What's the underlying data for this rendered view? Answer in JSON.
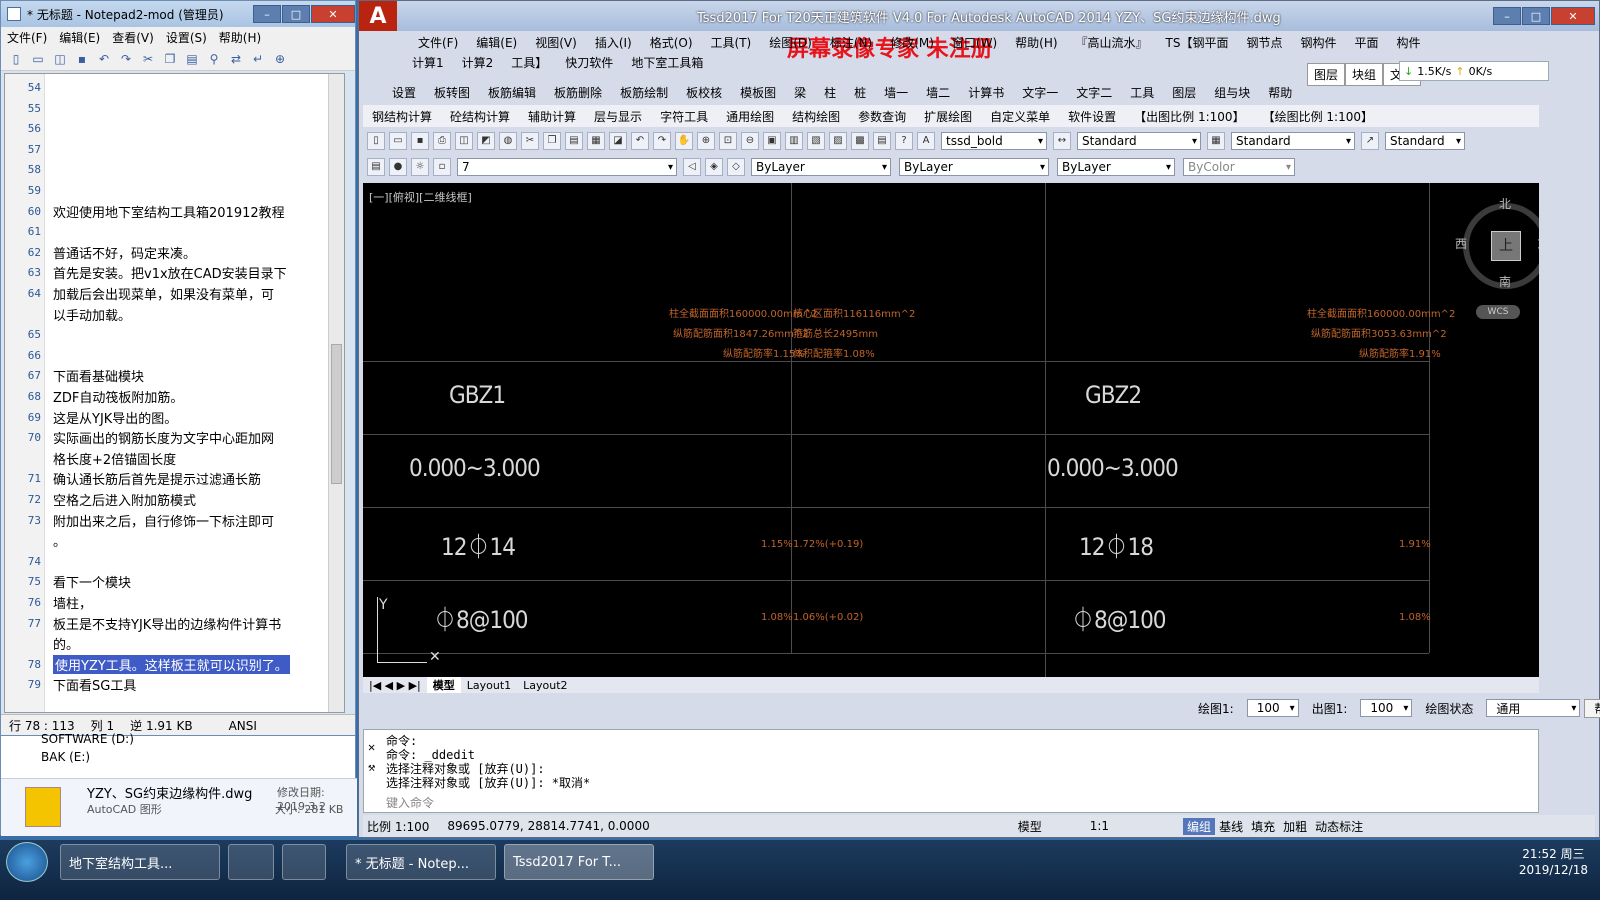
{
  "notepad": {
    "title": "* 无标题 - Notepad2-mod (管理员)",
    "menu": [
      "文件(F)",
      "编辑(E)",
      "查看(V)",
      "设置(S)",
      "帮助(H)"
    ],
    "lines": [
      {
        "n": "54",
        "t": ""
      },
      {
        "n": "55",
        "t": ""
      },
      {
        "n": "56",
        "t": ""
      },
      {
        "n": "57",
        "t": ""
      },
      {
        "n": "58",
        "t": ""
      },
      {
        "n": "59",
        "t": ""
      },
      {
        "n": "60",
        "t": "欢迎使用地下室结构工具箱201912教程"
      },
      {
        "n": "61",
        "t": ""
      },
      {
        "n": "62",
        "t": "普通话不好，码定来凑。"
      },
      {
        "n": "63",
        "t": "首先是安装。把v1x放在CAD安装目录下"
      },
      {
        "n": "64",
        "t": "加载后会出现菜单，如果没有菜单，可"
      },
      {
        "n": "",
        "t": "以手动加载。"
      },
      {
        "n": "65",
        "t": ""
      },
      {
        "n": "66",
        "t": ""
      },
      {
        "n": "67",
        "t": "下面看基础模块"
      },
      {
        "n": "68",
        "t": "ZDF自动筏板附加筋。"
      },
      {
        "n": "69",
        "t": "这是从YJK导出的图。"
      },
      {
        "n": "70",
        "t": "实际画出的钢筋长度为文字中心距加网"
      },
      {
        "n": "",
        "t": "格长度+2倍锚固长度"
      },
      {
        "n": "71",
        "t": "确认通长筋后首先是提示过滤通长筋"
      },
      {
        "n": "72",
        "t": "空格之后进入附加筋模式"
      },
      {
        "n": "73",
        "t": "附加出来之后，自行修饰一下标注即可"
      },
      {
        "n": "",
        "t": "。"
      },
      {
        "n": "74",
        "t": ""
      },
      {
        "n": "75",
        "t": "看下一个模块"
      },
      {
        "n": "76",
        "t": "墙柱，"
      },
      {
        "n": "77",
        "t": "板王是不支持YJK导出的边缘构件计算书"
      },
      {
        "n": "",
        "t": "的。"
      },
      {
        "n": "78",
        "t": "使用YZY工具。这样板王就可以识别了。"
      },
      {
        "n": "79",
        "t": "下面看SG工具"
      }
    ],
    "status": {
      "pos": "行 78 : 113",
      "col": "列 1",
      "size": "逆 1.91 KB",
      "enc": "ANSI"
    }
  },
  "explorer": {
    "drive1": "SOFTWARE (D:)",
    "drive2": "BAK (E:)",
    "file": "YZY、SG约束边缘构件.dwg",
    "modified": "修改日期: 2019.3.2",
    "type": "AutoCAD 图形",
    "size": "大小: 281 KB"
  },
  "cad": {
    "title": "Tssd2017 For T20天正建筑软件 V4.0 For Autodesk AutoCAD 2014    YZY、SG约束边缘构件.dwg",
    "watermark": "屏幕录像专家  未注册",
    "menu1": [
      "文件(F)",
      "编辑(E)",
      "视图(V)",
      "插入(I)",
      "格式(O)",
      "工具(T)",
      "绘图(D)",
      "标注(N)",
      "修改(M)",
      "窗口(W)",
      "帮助(H)",
      "『高山流水』",
      "TS【钢平面",
      "钢节点",
      "钢构件",
      "平面",
      "构件"
    ],
    "menu2": [
      "计算1",
      "计算2",
      "工具】",
      "快刀软件",
      "地下室工具箱"
    ],
    "menu3": [
      "设置",
      "板转图",
      "板筋编辑",
      "板筋删除",
      "板筋绘制",
      "板校核",
      "模板图",
      "梁",
      "柱",
      "桩",
      "墙一",
      "墙二",
      "计算书",
      "文字一",
      "文字二",
      "工具",
      "图层",
      "组与块",
      "帮助"
    ],
    "menu4": [
      "钢结构计算",
      "砼结构计算",
      "辅助计算",
      "层与显示",
      "字符工具",
      "通用绘图",
      "结构绘图",
      "参数查询",
      "扩展绘图",
      "自定义菜单",
      "软件设置",
      "【出图比例 1:100】",
      "【绘图比例 1:100】"
    ],
    "right_tabs": [
      "图层",
      "块组",
      "文字"
    ],
    "net": {
      "down": "1.5K/s",
      "up": "0K/s"
    },
    "style_combo": "tssd_bold",
    "dim_combo": "Standard",
    "table_combo": "Standard",
    "mleader": "Standard",
    "layer": "7",
    "color": "ByLayer",
    "linetype": "ByLayer",
    "lineweight": "ByLayer",
    "plotstyle": "ByColor",
    "viewport_label": "[一][俯视][二维线框]",
    "cells": {
      "a_notes": [
        "柱全截面面积160000.00mm^2",
        "纵筋配筋面积1847.26mm^2",
        "纵筋配筋率1.15%"
      ],
      "b_notes": [
        "核心区面积116116mm^2",
        "箍筋总长2495mm",
        "体积配箍率1.08%"
      ],
      "c_notes": [
        "柱全截面面积160000.00mm^2",
        "纵筋配筋面积3053.63mm^2",
        "纵筋配筋率1.91%"
      ],
      "gbz1": "GBZ1",
      "gbz2": "GBZ2",
      "h1": "0.000~3.000",
      "h2": "0.000~3.000",
      "r1": "12⏀14",
      "r2": "12⏀18",
      "s1": "⏀8@100",
      "s2": "⏀8@100",
      "p1": "1.15%",
      "p1b": "1.72%(+0.19)",
      "p2": "1.91%",
      "q1": "1.08%",
      "q1b": "1.06%(+0.02)",
      "q2": "1.08%"
    },
    "compass": {
      "n": "北",
      "s": "南",
      "e": "东",
      "w": "西",
      "top": "上",
      "wcs": "WCS"
    },
    "tabs": [
      "模型",
      "Layout1",
      "Layout2"
    ],
    "scale_bar": {
      "draw_label": "绘图1:",
      "draw_val": "100",
      "out_label": "出图1:",
      "out_val": "100",
      "state_label": "绘图状态",
      "state_val": "通用",
      "help": "帮助"
    },
    "cmd": [
      "命令:",
      "命令: _ddedit",
      "选择注释对象或 [放弃(U)]:",
      "选择注释对象或 [放弃(U)]: *取消*"
    ],
    "cmd_placeholder": "键入命令",
    "status": {
      "scale": "比例 1:100",
      "coords": "89695.0779, 28814.7741, 0.0000",
      "model": "模型",
      "anno": "1:1",
      "right": [
        "编组",
        "基线",
        "填充",
        "加粗",
        "动态标注"
      ]
    }
  },
  "taskbar": {
    "items": [
      "地下室结构工具...",
      "* 无标题 - Notep...",
      "Tssd2017 For T..."
    ],
    "time": "21:52 周三",
    "date": "2019/12/18"
  }
}
